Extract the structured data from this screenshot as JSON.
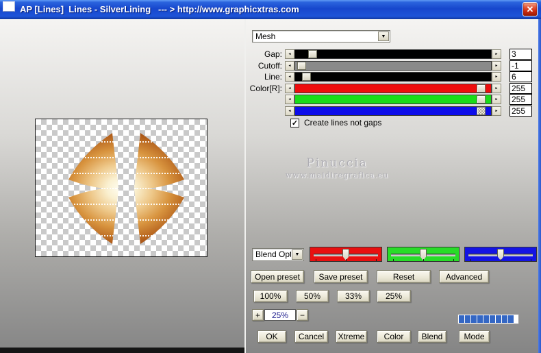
{
  "window": {
    "title": "AP [Lines]  Lines - SilverLining   --- > http://www.graphicxtras.com"
  },
  "icons": {
    "close": "✕",
    "dropdown": "▼",
    "left_arrow": "◄",
    "right_arrow": "►",
    "check": "✓"
  },
  "preset_dropdown": {
    "value": "Mesh"
  },
  "sliders": [
    {
      "label": "Gap:",
      "value": "3",
      "track_color": "#000000",
      "thumb_pos": 0.07,
      "thumb_checkered": false
    },
    {
      "label": "Cutoff:",
      "value": "-1",
      "track_color": "#8a8a8a",
      "thumb_pos": 0.012,
      "thumb_checkered": false
    },
    {
      "label": "Line:",
      "value": "6",
      "track_color": "#000000",
      "thumb_pos": 0.036,
      "thumb_checkered": false
    },
    {
      "label": "Color[R]:",
      "value": "255",
      "track_color": "#ee0d0d",
      "thumb_pos": 0.97,
      "thumb_checkered": false
    },
    {
      "label": "",
      "value": "255",
      "track_color": "#19dc19",
      "thumb_pos": 0.97,
      "thumb_checkered": false
    },
    {
      "label": "",
      "value": "255",
      "track_color": "#0d0dea",
      "thumb_pos": 0.97,
      "thumb_checkered": true
    }
  ],
  "checkbox": {
    "label": "Create lines not gaps",
    "checked": true
  },
  "watermark": {
    "line1": "Pinuccia",
    "line2": "www.maidiregrafica.eu"
  },
  "blend_dropdown": {
    "value": "Blend Opti"
  },
  "mixer": {
    "channels": [
      {
        "name": "red",
        "color": "#e81010"
      },
      {
        "name": "green",
        "color": "#28dc28"
      },
      {
        "name": "blue",
        "color": "#1414e4"
      }
    ]
  },
  "preset_buttons": [
    "Open preset",
    "Save preset",
    "Reset",
    "Advanced"
  ],
  "zoom_buttons": [
    "100%",
    "50%",
    "33%",
    "25%"
  ],
  "zoom_stepper": {
    "plus": "+",
    "value": "25%",
    "minus": "−"
  },
  "progress": {
    "segments": 9,
    "color": "#3467c4"
  },
  "action_buttons": [
    "OK",
    "Cancel",
    "Xtreme",
    "Color",
    "Blend",
    "Mode"
  ]
}
